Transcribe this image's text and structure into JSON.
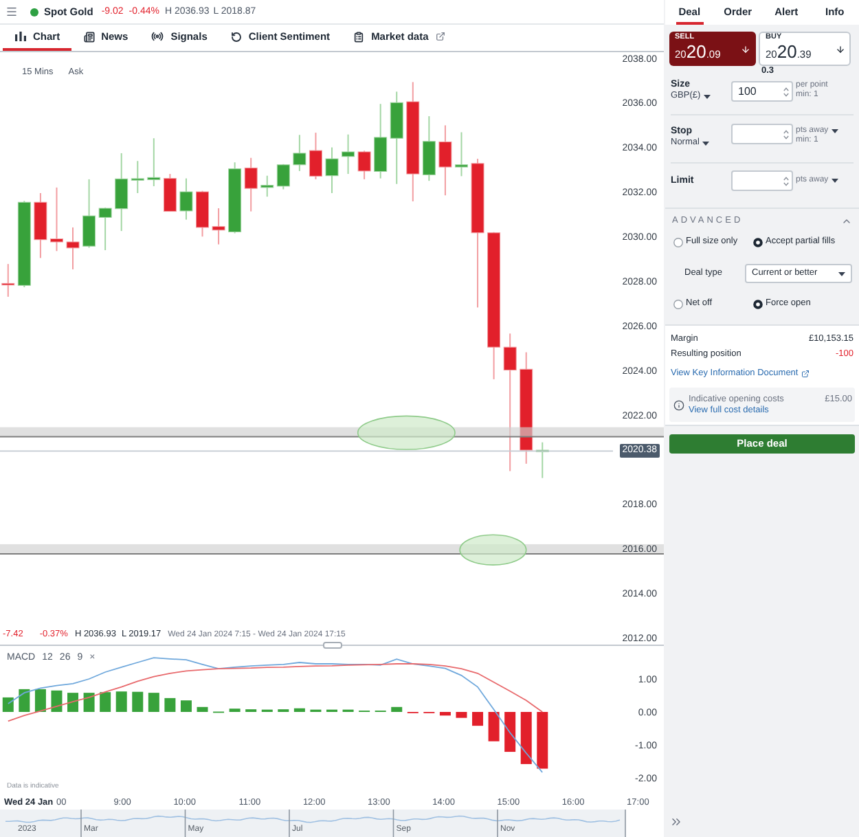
{
  "top_bar": {
    "market_open": true,
    "instrument": "Spot Gold",
    "change": "-9.02",
    "change_percent": "-0.44%",
    "high": "H 2036.93",
    "low": "L 2018.87"
  },
  "chart_tabs": [
    {
      "label": "Chart",
      "selected": true,
      "external": false
    },
    {
      "label": "News",
      "selected": false,
      "external": false
    },
    {
      "label": "Signals",
      "selected": false,
      "external": false
    },
    {
      "label": "Client Sentiment",
      "selected": false,
      "external": false
    },
    {
      "label": "Market data",
      "selected": false,
      "external": true
    }
  ],
  "chart": {
    "interval": "15 Mins",
    "price_type": "Ask",
    "chart_data": {
      "type": "candlestick",
      "categories": [
        null,
        null,
        null,
        null,
        null,
        null,
        null,
        null,
        null,
        null,
        null,
        null,
        null,
        null,
        null,
        null,
        null,
        null,
        null,
        null,
        null,
        null,
        null,
        null,
        null,
        null,
        null,
        null,
        null,
        null,
        null,
        null,
        null,
        null,
        null,
        null,
        null,
        null,
        null,
        null,
        null
      ],
      "ohlc": [
        [
          2027.9,
          2028.77,
          2027.3,
          2027.85
        ],
        [
          2027.81,
          2031.6,
          2027.73,
          2031.54
        ],
        [
          2031.54,
          2031.95,
          2029.04,
          2029.86
        ],
        [
          2029.9,
          2032.2,
          2029.35,
          2029.76
        ],
        [
          2029.76,
          2030.41,
          2028.53,
          2029.49
        ],
        [
          2029.57,
          2032.57,
          2029.5,
          2030.93
        ],
        [
          2030.86,
          2031.3,
          2029.39,
          2031.27
        ],
        [
          2031.25,
          2033.74,
          2030.25,
          2032.59
        ],
        [
          2032.55,
          2033.39,
          2031.95,
          2032.6
        ],
        [
          2032.55,
          2034.41,
          2032.26,
          2032.65
        ],
        [
          2032.61,
          2032.81,
          2031.13,
          2031.13
        ],
        [
          2031.15,
          2032.61,
          2030.76,
          2032.01
        ],
        [
          2032.01,
          2032.05,
          2030.0,
          2030.41
        ],
        [
          2030.45,
          2031.27,
          2029.65,
          2030.29
        ],
        [
          2030.21,
          2033.33,
          2030.15,
          2033.04
        ],
        [
          2033.08,
          2033.53,
          2031.13,
          2032.16
        ],
        [
          2032.2,
          2032.73,
          2031.79,
          2032.3
        ],
        [
          2032.26,
          2033.25,
          2032.12,
          2033.22
        ],
        [
          2033.22,
          2034.56,
          2032.94,
          2033.74
        ],
        [
          2033.86,
          2034.66,
          2032.57,
          2032.71
        ],
        [
          2032.73,
          2034.0,
          2031.95,
          2033.49
        ],
        [
          2033.59,
          2034.58,
          2032.81,
          2033.8
        ],
        [
          2033.8,
          2033.85,
          2032.57,
          2032.94
        ],
        [
          2032.92,
          2035.95,
          2032.61,
          2034.45
        ],
        [
          2034.41,
          2036.5,
          2032.36,
          2036.01
        ],
        [
          2036.05,
          2036.93,
          2031.58,
          2032.81
        ],
        [
          2032.77,
          2035.4,
          2032.5,
          2034.27
        ],
        [
          2034.25,
          2034.99,
          2031.85,
          2033.12
        ],
        [
          2033.12,
          2034.68,
          2032.71,
          2033.22
        ],
        [
          2033.28,
          2033.49,
          2026.82,
          2030.17
        ],
        [
          2030.17,
          2030.2,
          2023.6,
          2025.04
        ],
        [
          2025.04,
          2025.65,
          2019.48,
          2024.01
        ],
        [
          2024.05,
          2024.81,
          2019.81,
          2020.42
        ],
        [
          2020.35,
          2020.77,
          2019.17,
          2020.42
        ],
        null,
        null,
        null,
        null,
        null,
        null,
        null
      ],
      "ylim": [
        2012,
        2038.3
      ],
      "yticks": [
        {
          "value": 2038,
          "label": "2038.00"
        },
        {
          "value": 2036,
          "label": "2036.00"
        },
        {
          "value": 2034,
          "label": "2034.00"
        },
        {
          "value": 2032,
          "label": "2032.00"
        },
        {
          "value": 2030,
          "label": "2030.00"
        },
        {
          "value": 2028,
          "label": "2028.00"
        },
        {
          "value": 2026,
          "label": "2026.00"
        },
        {
          "value": 2024,
          "label": "2024.00"
        },
        {
          "value": 2022,
          "label": "2022.00"
        },
        {
          "value": 2018,
          "label": "2018.00"
        },
        {
          "value": 2016,
          "label": "2016.00"
        },
        {
          "value": 2014,
          "label": "2014.00"
        },
        {
          "value": 2012,
          "label": "2012.00"
        }
      ],
      "ref_lines": [
        {
          "axis": "y",
          "value": 2020.38,
          "label": "2020.38"
        }
      ],
      "bands": [
        {
          "axis": "y",
          "from": 2021.02,
          "to": 2021.45
        },
        {
          "axis": "y",
          "from": 2015.77,
          "to": 2016.2
        }
      ]
    },
    "summary": {
      "change": "-7.42",
      "change_percent": "-0.37%",
      "high": "H 2036.93",
      "low": "L 2019.17",
      "period": "Wed 24 Jan 2024 7:15 - Wed 24 Jan 2024 17:15"
    }
  },
  "macd": {
    "name": "MACD",
    "params": [
      "12",
      "26",
      "9"
    ],
    "close": "×",
    "note": "Data is indicative",
    "chart_data": {
      "type": "bar",
      "x": [
        7.25,
        7.5,
        7.75,
        8,
        8.25,
        8.5,
        8.75,
        9,
        9.25,
        9.5,
        9.75,
        10,
        10.25,
        10.5,
        10.75,
        11,
        11.25,
        11.5,
        11.75,
        12,
        12.25,
        12.5,
        12.75,
        13,
        13.25,
        13.5,
        13.75,
        14,
        14.25,
        14.5,
        14.75,
        15,
        15.25,
        15.5
      ],
      "series": [
        {
          "colors": [
            "#38a23b",
            "#38a23b",
            "#38a23b",
            "#38a23b",
            "#38a23b",
            "#38a23b",
            "#38a23b",
            "#38a23b",
            "#38a23b",
            "#38a23b",
            "#38a23b",
            "#38a23b",
            "#38a23b",
            "#38a23b",
            "#38a23b",
            "#38a23b",
            "#38a23b",
            "#38a23b",
            "#38a23b",
            "#38a23b",
            "#38a23b",
            "#38a23b",
            "#38a23b",
            "#38a23b",
            "#38a23b",
            "#e2202b",
            "#e2202b",
            "#e2202b",
            "#e2202b",
            "#e2202b",
            "#e2202b",
            "#e2202b",
            "#e2202b",
            "#e2202b"
          ],
          "values": [
            0.44,
            0.69,
            0.69,
            0.65,
            0.58,
            0.58,
            0.6,
            0.62,
            0.61,
            0.58,
            0.42,
            0.35,
            0.15,
            0.01,
            0.1,
            0.08,
            0.07,
            0.08,
            0.11,
            0.07,
            0.07,
            0.07,
            0.04,
            0.04,
            0.15,
            -0.01,
            -0.02,
            -0.11,
            -0.18,
            -0.42,
            -0.89,
            -1.21,
            -1.58,
            -1.72
          ]
        },
        {
          "type": "line",
          "color": "#6fa8dc",
          "values": [
            0.25,
            0.58,
            0.72,
            0.8,
            0.86,
            1.0,
            1.21,
            1.36,
            1.5,
            1.64,
            1.61,
            1.58,
            1.44,
            1.31,
            1.36,
            1.39,
            1.42,
            1.44,
            1.5,
            1.46,
            1.46,
            1.44,
            1.44,
            1.42,
            1.6,
            1.46,
            1.39,
            1.32,
            1.11,
            0.76,
            0.07,
            -0.63,
            -1.25,
            -1.83
          ]
        },
        {
          "type": "line",
          "color": "#e8696c",
          "values": [
            -0.28,
            -0.11,
            0.03,
            0.17,
            0.31,
            0.44,
            0.61,
            0.76,
            0.93,
            1.07,
            1.17,
            1.24,
            1.28,
            1.31,
            1.32,
            1.33,
            1.35,
            1.36,
            1.38,
            1.39,
            1.4,
            1.42,
            1.43,
            1.44,
            1.46,
            1.46,
            1.44,
            1.39,
            1.31,
            1.17,
            0.9,
            0.63,
            0.35,
            0.0
          ]
        }
      ],
      "xlim": [
        7.125,
        17.375
      ],
      "ylim": [
        -3.75,
        2.0
      ],
      "xticks": [
        {
          "value": 9,
          "label": "9:00"
        },
        {
          "value": 10,
          "label": "10:00"
        },
        {
          "value": 11,
          "label": "11:00"
        },
        {
          "value": 12,
          "label": "12:00"
        },
        {
          "value": 13,
          "label": "13:00"
        },
        {
          "value": 14,
          "label": "14:00"
        },
        {
          "value": 15,
          "label": "15:00"
        },
        {
          "value": 16,
          "label": "16:00"
        },
        {
          "value": 17,
          "label": "17:00"
        }
      ],
      "yticks": [
        {
          "value": 1,
          "label": "1.00"
        },
        {
          "value": 0,
          "label": "0.00"
        },
        {
          "value": -1,
          "label": "-1.00"
        },
        {
          "value": -2,
          "label": "-2.00"
        }
      ]
    }
  },
  "time_axis": {
    "date": "Wed 24 Jan",
    "cut_label": "00"
  },
  "navigator": {
    "labels": [
      "2023",
      "Mar",
      "May",
      "Jul",
      "Sep",
      "Nov"
    ]
  },
  "deal_panel": {
    "tabs": [
      {
        "label": "Deal",
        "selected": true
      },
      {
        "label": "Order",
        "selected": false
      },
      {
        "label": "Alert",
        "selected": false
      },
      {
        "label": "Info",
        "selected": false
      }
    ],
    "sell": {
      "label": "SELL",
      "price": "2020.09"
    },
    "buy": {
      "label": "BUY",
      "price": "2020.39"
    },
    "spread": "0.3",
    "size": {
      "label": "Size",
      "currency": "GBP(£)",
      "value": "100",
      "unit": "per point",
      "min": "min: 1"
    },
    "stop": {
      "label": "Stop",
      "type": "Normal",
      "unit": "pts away",
      "min": "min: 1"
    },
    "limit": {
      "label": "Limit",
      "unit": "pts away"
    },
    "advanced": {
      "title": "ADVANCED",
      "expanded": true,
      "fill_options": [
        {
          "label": "Full size only",
          "selected": false
        },
        {
          "label": "Accept partial fills",
          "selected": true
        }
      ],
      "deal_type": {
        "label": "Deal type",
        "value": "Current or better"
      },
      "position_options": [
        {
          "label": "Net off",
          "selected": false
        },
        {
          "label": "Force open",
          "selected": true
        }
      ]
    },
    "summary": {
      "rows": [
        {
          "label": "Margin",
          "value": "£10,153.15",
          "negative": false
        },
        {
          "label": "Resulting position",
          "value": "-100",
          "negative": true
        }
      ],
      "kid_link": "View Key Information Document",
      "costs": {
        "label": "Indicative opening costs",
        "value": "£15.00",
        "link": "View full cost details"
      }
    },
    "place_deal": "Place deal"
  }
}
